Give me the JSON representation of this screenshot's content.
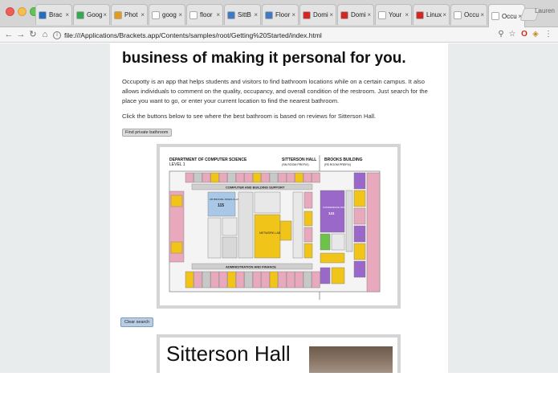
{
  "browser": {
    "tabs": [
      {
        "label": "Brac",
        "icon": "brackets-icon",
        "color": "#1f6fc2"
      },
      {
        "label": "Goog",
        "icon": "google-drive-icon",
        "color": "#34a853"
      },
      {
        "label": "Phot",
        "icon": "photopea-icon",
        "color": "#e59b17"
      },
      {
        "label": "goog",
        "icon": "google-icon",
        "color": "#ffffff"
      },
      {
        "label": "floor",
        "icon": "google-icon",
        "color": "#ffffff"
      },
      {
        "label": "SittB",
        "icon": "unc-icon",
        "color": "#3e7bc4"
      },
      {
        "label": "Floor",
        "icon": "unc-icon",
        "color": "#3e7bc4"
      },
      {
        "label": "Domi",
        "icon": "opera-icon",
        "color": "#d7261f"
      },
      {
        "label": "Domi",
        "icon": "opera-icon",
        "color": "#d7261f"
      },
      {
        "label": "Your",
        "icon": "gmail-icon",
        "color": "#ffffff"
      },
      {
        "label": "Linux",
        "icon": "opera-icon",
        "color": "#d7261f"
      },
      {
        "label": "Occu",
        "icon": "page-icon",
        "color": "#ffffff"
      },
      {
        "label": "Occu",
        "icon": "page-icon",
        "color": "#ffffff",
        "active": true
      }
    ],
    "profile_name": "Lauren",
    "address": "file:///Applications/Brackets.app/Contents/samples/root/Getting%20Started/index.html"
  },
  "page": {
    "heading": "business of making it personal for you.",
    "intro": "Occupotty is an app that helps students and visitors to find bathroom locations while on a certain campus. It also allows individuals to comment on the quality, occupancy, and overall condition of the restroom. Just search for the place you want to go, or enter your current location to find the nearest bathroom.",
    "instruction": "Click the buttons below to see where the best bathroom is based on reviews for Sitterson Hall.",
    "find_button": "Find private bathroom",
    "clear_button": "Clear search",
    "map": {
      "dept_title": "DEPARTMENT OF COMPUTER SCIENCE",
      "level": "LEVEL 1",
      "building1": "SITTERSON HALL",
      "building1_prefix": "(SN ROOM PREFIX)",
      "building2": "BROOKS BUILDING",
      "building2_prefix": "(FB ROOM PREFIX)",
      "band_top": "COMPUTER AND BUILDING SUPPORT",
      "band_bottom": "ADMINISTRATION AND FINANCE",
      "room_classroom": "UB BRONZE JONES CLASSROOM",
      "room_classroom_num": "115",
      "room_network": "NETWORK LAB",
      "room_conference": "CONFERENCE ROOM",
      "room_conference_num": "141"
    },
    "card_title": "Sitterson Hall"
  },
  "colors": {
    "pink": "#e9a9bd",
    "yellow": "#f0c419",
    "blue": "#a9c8e8",
    "purple": "#9a68c8",
    "green": "#6cc24a",
    "gray": "#c8c8c8"
  }
}
